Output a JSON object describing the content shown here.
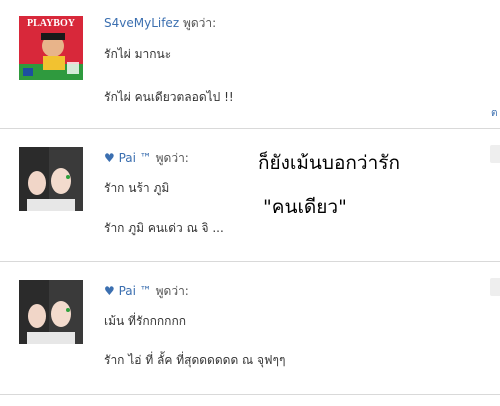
{
  "posts": [
    {
      "author": "S4veMyLifez",
      "heart": "",
      "says": "พูดว่า:",
      "avatar_logo": "PLAYBOY",
      "avatar_icon": "playboy-magazine-avatar",
      "lines": [
        "รักไผ่ มากนะ",
        "รักไผ่ คนเดียวตลอดไป !!"
      ]
    },
    {
      "author": "Pai ™",
      "heart": "♥",
      "says": "พูดว่า:",
      "avatar_icon": "two-girls-photo-avatar",
      "lines": [
        "รัาก นร้า ภูมิ",
        "รัาก ภูมิ คนเด่ว ณ จิ ..."
      ]
    },
    {
      "author": "Pai ™",
      "heart": "♥",
      "says": "พูดว่า:",
      "avatar_icon": "two-girls-photo-avatar",
      "lines": [
        "เม้น ที่รักกกกกก",
        "รัาก ไอ่ ที่ ลั้ค ที่สุดดดดดด ณ จุฟๆๆ"
      ]
    }
  ],
  "side_link": "ต",
  "overlay": {
    "line1": "ก็ยังเม้นบอกว่ารัก",
    "line2": "\"คนเดียว\""
  },
  "colors": {
    "author": "#3b6fb0",
    "divider": "#d9d9d9",
    "avatar_red": "#d8283a"
  }
}
